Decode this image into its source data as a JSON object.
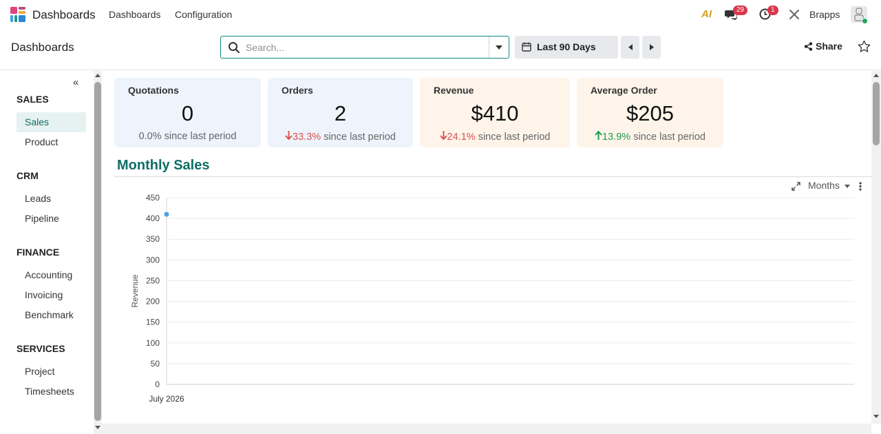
{
  "navbar": {
    "app_name": "Dashboards",
    "menus": [
      "Dashboards",
      "Configuration"
    ],
    "ai_label": "AI",
    "messages_badge": "29",
    "activities_badge": "1",
    "company": "Brapps"
  },
  "control_panel": {
    "breadcrumb": "Dashboards",
    "search_placeholder": "Search...",
    "period": "Last 90 Days",
    "share_label": "Share"
  },
  "sidebar": {
    "sections": [
      {
        "title": "SALES",
        "items": [
          "Sales",
          "Product"
        ]
      },
      {
        "title": "CRM",
        "items": [
          "Leads",
          "Pipeline"
        ]
      },
      {
        "title": "FINANCE",
        "items": [
          "Accounting",
          "Invoicing",
          "Benchmark"
        ]
      },
      {
        "title": "SERVICES",
        "items": [
          "Project",
          "Timesheets"
        ]
      }
    ],
    "active_item": "Sales"
  },
  "kpis": [
    {
      "title": "Quotations",
      "value": "0",
      "delta": "0.0%",
      "trend": "flat",
      "suffix": "since last period"
    },
    {
      "title": "Orders",
      "value": "2",
      "delta": "33.3%",
      "trend": "down",
      "suffix": "since last period"
    },
    {
      "title": "Revenue",
      "value": "$410",
      "delta": "24.1%",
      "trend": "down",
      "suffix": "since last period"
    },
    {
      "title": "Average Order",
      "value": "$205",
      "delta": "13.9%",
      "trend": "up",
      "suffix": "since last period"
    }
  ],
  "section_title": "Monthly Sales",
  "chart_tools": {
    "group_by": "Months"
  },
  "colors": {
    "accent": "#0e6e66",
    "down": "#d9534f",
    "up": "#1f9b4f",
    "point": "#4da3e8"
  },
  "chart_data": {
    "type": "line",
    "categories": [
      "July 2026"
    ],
    "series": [
      {
        "values": [
          410
        ]
      }
    ],
    "ylabel": "Revenue",
    "ylim": [
      0,
      450
    ],
    "yticks": [
      0,
      50,
      100,
      150,
      200,
      250,
      300,
      350,
      400,
      450
    ],
    "grid": true
  }
}
